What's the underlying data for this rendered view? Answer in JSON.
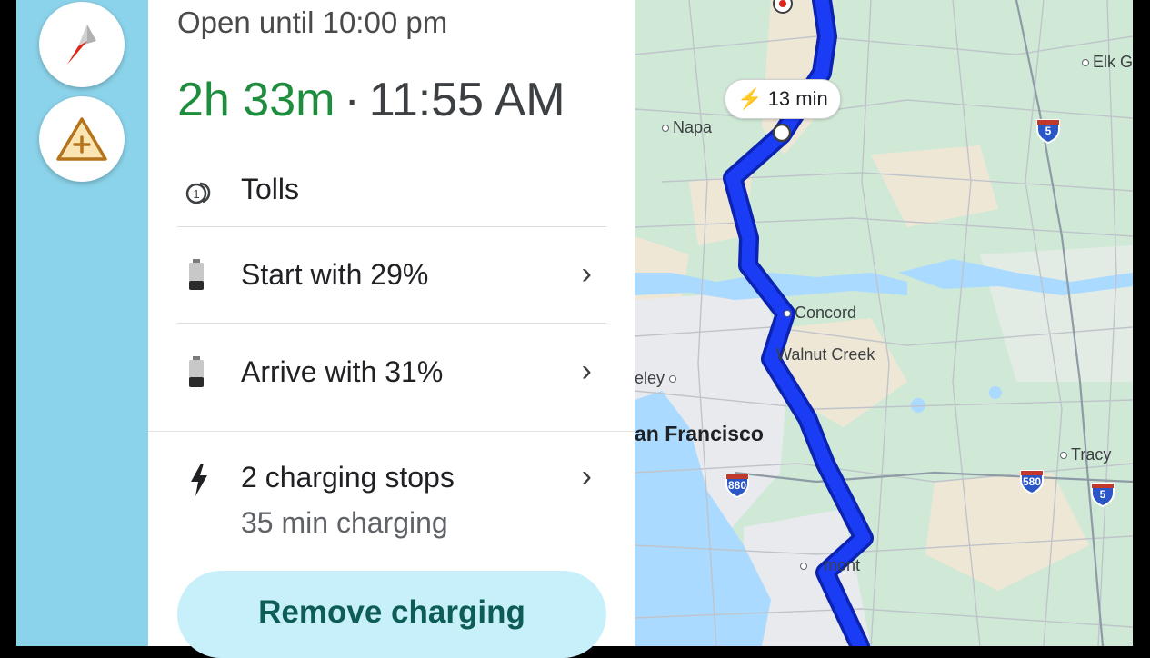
{
  "place": {
    "hours": "Open until 10:00 pm"
  },
  "trip": {
    "duration": "2h 33m",
    "separator": "·",
    "arrival_time": "11:55 AM"
  },
  "rows": {
    "tolls": {
      "label": "Tolls",
      "icon": "toll-icon"
    },
    "start_battery": {
      "label": "Start with 29%",
      "icon": "battery-icon",
      "percent": 29
    },
    "arrive_battery": {
      "label": "Arrive with 31%",
      "icon": "battery-icon",
      "percent": 31
    },
    "charging": {
      "label": "2 charging stops",
      "sublabel": "35 min charging",
      "icon": "bolt-icon"
    }
  },
  "remove_charging_label": "Remove charging",
  "map": {
    "segment_time": "13 min",
    "cities": {
      "napa": "Napa",
      "elk_grove": "Elk G",
      "concord": "Concord",
      "walnut_creek": "Walnut Creek",
      "berkeley": "eley",
      "san_francisco": "an Francisco",
      "tracy": "Tracy",
      "fremont": "mont"
    },
    "shields": {
      "i5_north": "5",
      "i880": "880",
      "i580": "580",
      "i5_south": "5"
    },
    "colors": {
      "route": "#1a3cf5",
      "route_outline": "#0b23b0",
      "water": "#aadaff",
      "land": "#cfe9d6"
    }
  },
  "colors": {
    "accent_green": "#1e8e3e",
    "rail": "#8bd3ea",
    "remove_button_bg": "#c7f0fb",
    "remove_button_text": "#0d5d56"
  }
}
